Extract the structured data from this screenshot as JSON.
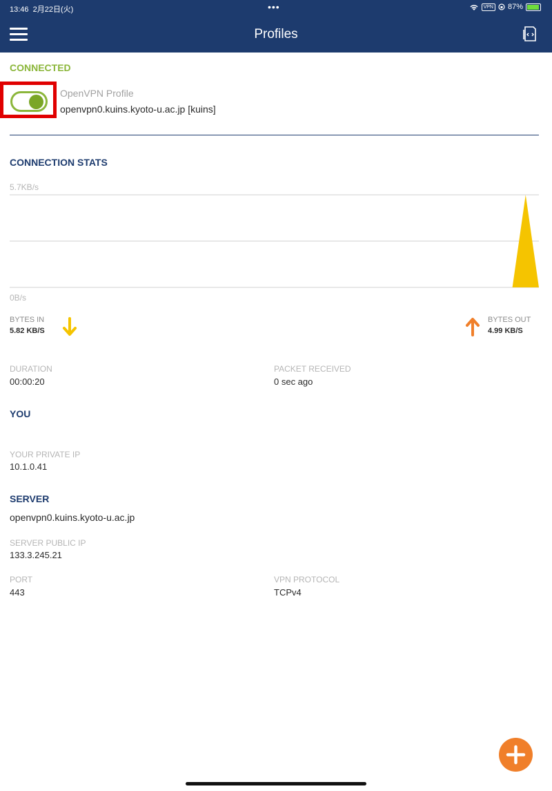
{
  "status_bar": {
    "time": "13:46",
    "date": "2月22日(火)",
    "battery_percent": "87%",
    "vpn_badge": "VPN"
  },
  "header": {
    "title": "Profiles"
  },
  "connection": {
    "status_label": "CONNECTED",
    "toggle_on": true,
    "profile_type": "OpenVPN Profile",
    "profile_host": "openvpn0.kuins.kyoto-u.ac.jp [kuins]"
  },
  "stats": {
    "title": "CONNECTION STATS",
    "bytes_in_label": "BYTES IN",
    "bytes_in_value": "5.82 KB/S",
    "bytes_out_label": "BYTES OUT",
    "bytes_out_value": "4.99 KB/S",
    "duration_label": "DURATION",
    "duration_value": "00:00:20",
    "packet_label": "PACKET RECEIVED",
    "packet_value": "0 sec ago"
  },
  "chart_data": {
    "type": "area",
    "ylabel_top": "5.7KB/s",
    "ylabel_bottom": "0B/s",
    "ylim": [
      0,
      5.7
    ],
    "series": [
      {
        "color": "#f5c400",
        "values": [
          0,
          0,
          0,
          0,
          0,
          0,
          0,
          0,
          0,
          0,
          0,
          0,
          0,
          0,
          0,
          0,
          0,
          0,
          0,
          0,
          0,
          0,
          0,
          0,
          0,
          0,
          0,
          0,
          0,
          0,
          0,
          0,
          0,
          0,
          0,
          0,
          0,
          0,
          0,
          5.7,
          0
        ]
      }
    ],
    "grid": true
  },
  "you": {
    "title": "YOU",
    "private_ip_label": "YOUR PRIVATE IP",
    "private_ip_value": "10.1.0.41"
  },
  "server": {
    "title": "SERVER",
    "hostname": "openvpn0.kuins.kyoto-u.ac.jp",
    "public_ip_label": "SERVER PUBLIC IP",
    "public_ip_value": "133.3.245.21",
    "port_label": "PORT",
    "port_value": "443",
    "protocol_label": "VPN PROTOCOL",
    "protocol_value": "TCPv4"
  },
  "colors": {
    "navbar": "#1d3b6e",
    "connected": "#8bb63a",
    "bytes_in": "#f5c400",
    "bytes_out": "#f07f2a",
    "fab": "#f07f2a"
  },
  "icons": {
    "menu": "hamburger-icon",
    "import": "import-profile-icon",
    "in": "arrow-down-icon",
    "out": "arrow-up-icon",
    "add": "plus-icon"
  }
}
